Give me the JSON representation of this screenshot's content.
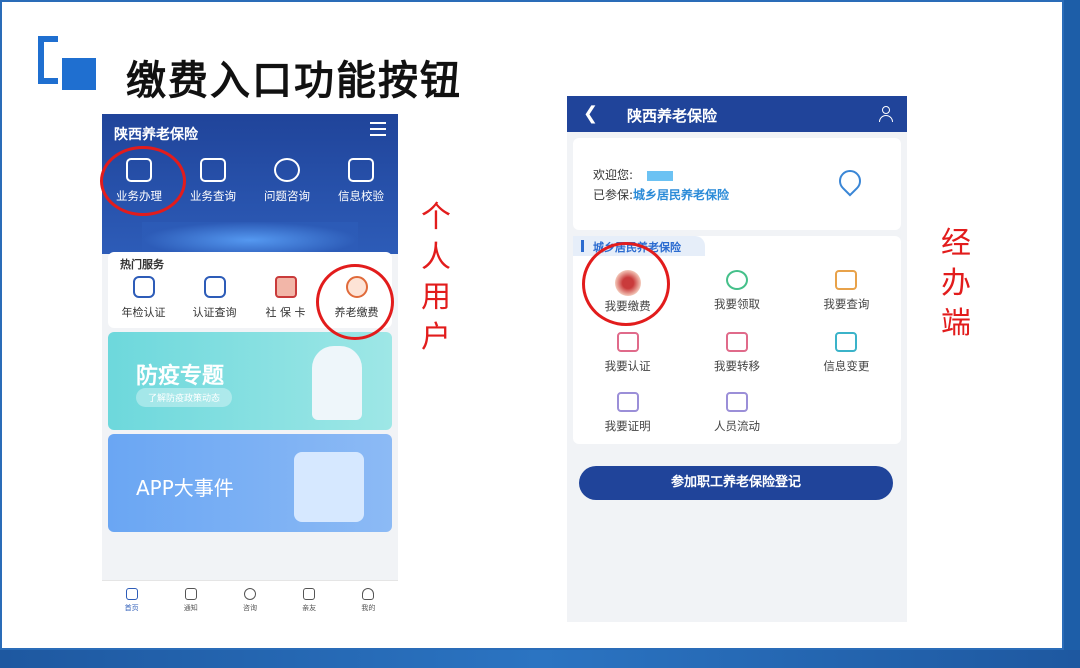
{
  "slide": {
    "title": "缴费入口功能按钮",
    "label_personal": [
      "个",
      "人",
      "用",
      "户"
    ],
    "label_agency": [
      "经",
      "办",
      "端"
    ]
  },
  "phone1": {
    "app_title": "陕西养老保险",
    "tools": [
      {
        "label": "业务办理",
        "icon": "monitor-icon"
      },
      {
        "label": "业务查询",
        "icon": "search-doc-icon"
      },
      {
        "label": "问题咨询",
        "icon": "question-icon"
      },
      {
        "label": "信息校验",
        "icon": "edit-doc-icon"
      }
    ],
    "hot_title": "热门服务",
    "hot_items": [
      {
        "label": "年检认证",
        "icon": "shield-user-icon"
      },
      {
        "label": "认证查询",
        "icon": "star-doc-icon"
      },
      {
        "label": "社 保 卡",
        "icon": "social-card-icon"
      },
      {
        "label": "养老缴费",
        "icon": "pension-pay-icon"
      }
    ],
    "banner1": {
      "title": "防疫专题",
      "link": "了解防疫政策动态"
    },
    "banner2": {
      "title": "APP大事件"
    },
    "tabbar": [
      {
        "label": "首页",
        "icon": "home-icon"
      },
      {
        "label": "通知",
        "icon": "bell-icon"
      },
      {
        "label": "咨询",
        "icon": "chat-icon"
      },
      {
        "label": "亲友",
        "icon": "heart-icon"
      },
      {
        "label": "我的",
        "icon": "user-icon"
      }
    ]
  },
  "phone2": {
    "app_title": "陕西养老保险",
    "welcome": "欢迎您:",
    "insured_label": "已参保:",
    "insured_value": "城乡居民养老保险",
    "section_title": "城乡居民养老保险",
    "grid": [
      {
        "label": "我要缴费",
        "icon": "seal-icon"
      },
      {
        "label": "我要领取",
        "icon": "receive-icon"
      },
      {
        "label": "我要查询",
        "icon": "query-icon"
      },
      {
        "label": "我要认证",
        "icon": "camera-icon"
      },
      {
        "label": "我要转移",
        "icon": "transfer-icon"
      },
      {
        "label": "信息变更",
        "icon": "change-info-icon"
      },
      {
        "label": "我要证明",
        "icon": "certificate-icon"
      },
      {
        "label": "人员流动",
        "icon": "flow-icon"
      }
    ],
    "register_button": "参加职工养老保险登记"
  }
}
